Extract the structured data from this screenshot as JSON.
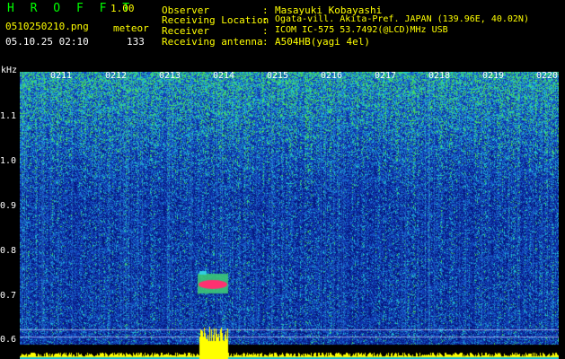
{
  "header": {
    "app_name": "H R O F F T",
    "version": "1.00",
    "filename": "0510250210.png",
    "mode": "meteor",
    "datetime": "05.10.25 02:10",
    "count": "133"
  },
  "info": [
    {
      "label": "Observer",
      "sep": ":",
      "value": "Masayuki Kobayashi"
    },
    {
      "label": "Receiving Location",
      "sep": ":",
      "value": "Ogata-vill. Akita-Pref. JAPAN (139.96E, 40.02N)"
    },
    {
      "label": "Receiver",
      "sep": ":",
      "value": "ICOM IC-575 53.7492(@LCD)MHz USB"
    },
    {
      "label": "Receiving antenna",
      "sep": ":",
      "value": "A504HB(yagi 4el)"
    }
  ],
  "spectrogram": {
    "y_unit": "kHz",
    "y_ticks": [
      "1.1",
      "1.0",
      "0.9",
      "0.8",
      "0.7",
      "0.6"
    ],
    "time_ticks": [
      "0211",
      "0212",
      "0213",
      "0214",
      "0215",
      "0216",
      "0217",
      "0218",
      "0219",
      "0220"
    ],
    "colors": {
      "background": "#000000",
      "noise_low": "#0a1e82",
      "noise_mid": "#1a60c8",
      "noise_high": "#20c8d0",
      "signal": "#40e060",
      "echo": "#ff3070",
      "peak": "#ffff00"
    }
  }
}
